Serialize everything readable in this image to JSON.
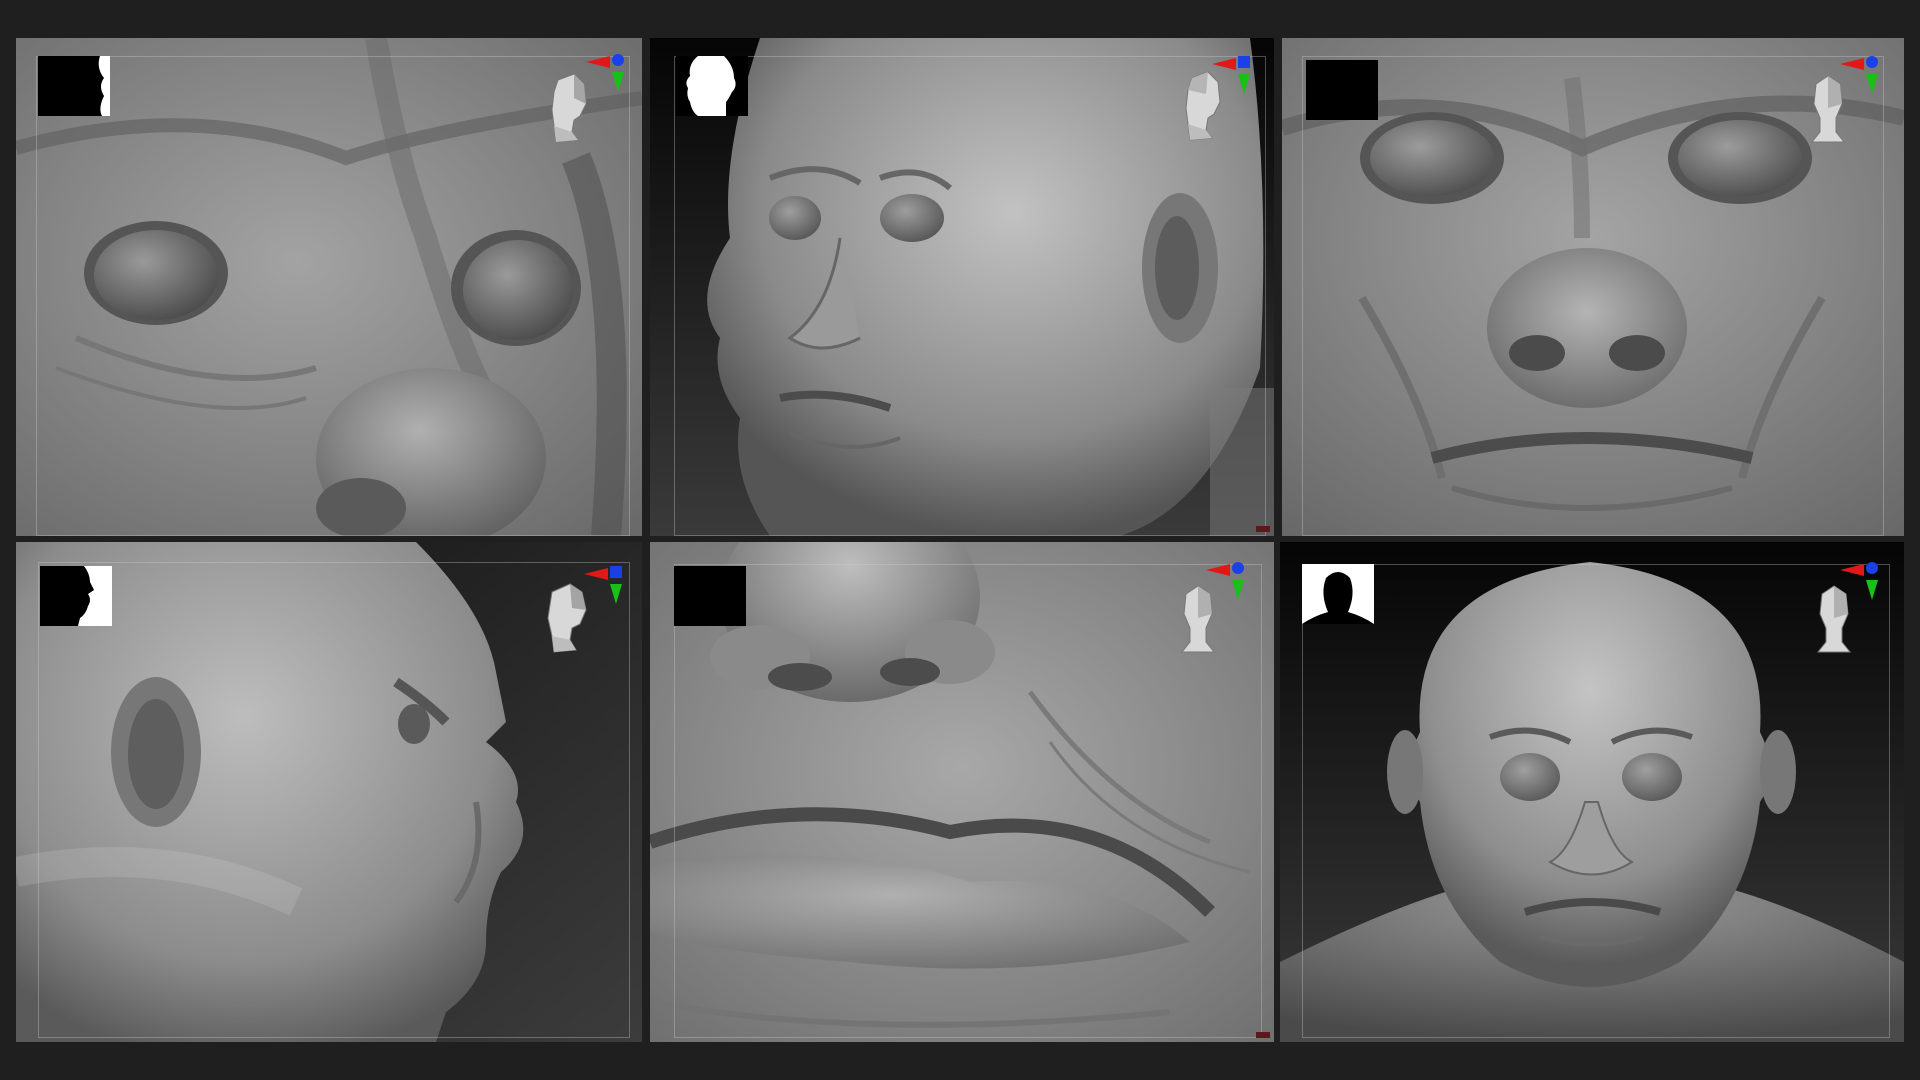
{
  "viewports": [
    {
      "id": "eye-nose-closeup",
      "silhouette": "partial-profile",
      "gizmo_icon": "axis-gizmo-icon",
      "nav_icon": "head-navigator-icon"
    },
    {
      "id": "three-quarter-head",
      "silhouette": "side-profile-left",
      "gizmo_icon": "axis-gizmo-icon",
      "nav_icon": "head-navigator-icon"
    },
    {
      "id": "front-eyes-nose",
      "silhouette": "solid-block",
      "gizmo_icon": "axis-gizmo-icon",
      "nav_icon": "head-navigator-icon"
    },
    {
      "id": "side-profile-head",
      "silhouette": "side-profile-right",
      "gizmo_icon": "axis-gizmo-icon",
      "nav_icon": "head-navigator-icon"
    },
    {
      "id": "nose-mouth-closeup",
      "silhouette": "solid-block",
      "gizmo_icon": "axis-gizmo-icon",
      "nav_icon": "head-navigator-icon"
    },
    {
      "id": "front-full-head",
      "silhouette": "front-head-shoulders",
      "gizmo_icon": "axis-gizmo-icon",
      "nav_icon": "head-navigator-icon"
    }
  ],
  "colors": {
    "background": "#1f1f1f",
    "clay": "#8a8a8a",
    "axis_red": "#e01818",
    "axis_green": "#18c018",
    "axis_blue": "#1a40e8"
  }
}
